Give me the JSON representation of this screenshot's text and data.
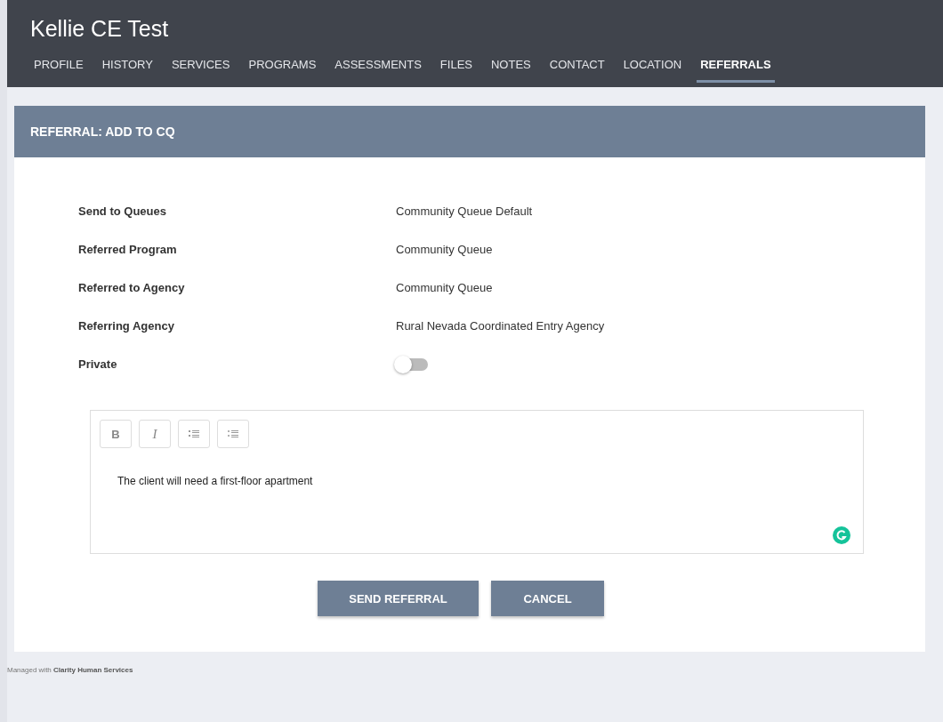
{
  "header": {
    "title": "Kellie CE Test"
  },
  "tabs": [
    {
      "label": "PROFILE",
      "selected": false
    },
    {
      "label": "HISTORY",
      "selected": false
    },
    {
      "label": "SERVICES",
      "selected": false
    },
    {
      "label": "PROGRAMS",
      "selected": false
    },
    {
      "label": "ASSESSMENTS",
      "selected": false
    },
    {
      "label": "FILES",
      "selected": false
    },
    {
      "label": "NOTES",
      "selected": false
    },
    {
      "label": "CONTACT",
      "selected": false
    },
    {
      "label": "LOCATION",
      "selected": false
    },
    {
      "label": "REFERRALS",
      "selected": true
    }
  ],
  "card": {
    "title": "REFERRAL: ADD TO CQ"
  },
  "fields": [
    {
      "kind": "text",
      "label": "Send to Queues",
      "value": "Community Queue Default"
    },
    {
      "kind": "text",
      "label": "Referred Program",
      "value": "Community Queue"
    },
    {
      "kind": "text",
      "label": "Referred to Agency",
      "value": "Community Queue"
    },
    {
      "kind": "text",
      "label": "Referring Agency",
      "value": "Rural Nevada Coordinated Entry Agency"
    },
    {
      "kind": "toggle",
      "label": "Private",
      "on": false
    }
  ],
  "editor": {
    "toolbar": [
      {
        "kind": "bold",
        "label": "B"
      },
      {
        "kind": "italic",
        "label": "I"
      },
      {
        "kind": "ordered"
      },
      {
        "kind": "bullet"
      }
    ],
    "value": "The client will need a first-floor apartment"
  },
  "buttons": [
    "SEND REFERRAL",
    "CANCEL"
  ],
  "footer": "Managed with **Clarity Human Services**"
}
